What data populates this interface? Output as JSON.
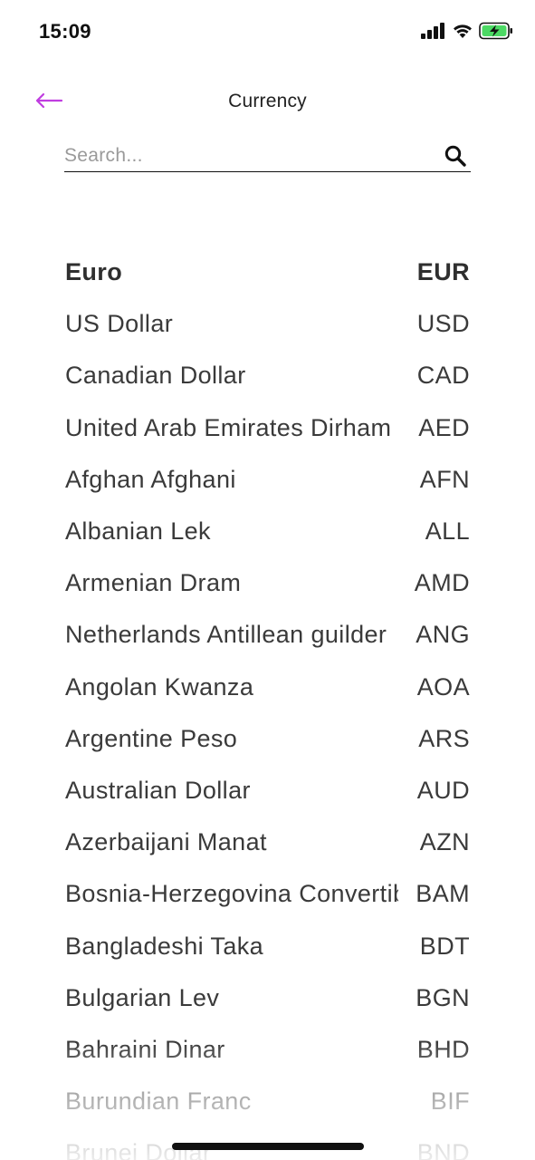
{
  "status_bar": {
    "time": "15:09",
    "icons": [
      "cellular-signal-icon",
      "wifi-icon",
      "battery-charging-icon"
    ],
    "battery_color": "#4cd964"
  },
  "header": {
    "title": "Currency",
    "back_icon": "arrow-left-icon",
    "accent_color": "#c03de0"
  },
  "search": {
    "placeholder": "Search...",
    "value": "",
    "icon": "search-icon"
  },
  "currencies": [
    {
      "name": "Euro",
      "code": "EUR",
      "selected": true
    },
    {
      "name": "US Dollar",
      "code": "USD"
    },
    {
      "name": "Canadian Dollar",
      "code": "CAD"
    },
    {
      "name": "United Arab Emirates Dirham",
      "code": "AED"
    },
    {
      "name": "Afghan Afghani",
      "code": "AFN"
    },
    {
      "name": "Albanian Lek",
      "code": "ALL"
    },
    {
      "name": "Armenian Dram",
      "code": "AMD"
    },
    {
      "name": "Netherlands Antillean guilder",
      "code": "ANG"
    },
    {
      "name": "Angolan Kwanza",
      "code": "AOA"
    },
    {
      "name": "Argentine Peso",
      "code": "ARS"
    },
    {
      "name": "Australian Dollar",
      "code": "AUD"
    },
    {
      "name": "Azerbaijani Manat",
      "code": "AZN"
    },
    {
      "name": "Bosnia-Herzegovina Convertible Mark",
      "code": "BAM"
    },
    {
      "name": "Bangladeshi Taka",
      "code": "BDT"
    },
    {
      "name": "Bulgarian Lev",
      "code": "BGN"
    },
    {
      "name": "Bahraini Dinar",
      "code": "BHD"
    },
    {
      "name": "Burundian Franc",
      "code": "BIF"
    },
    {
      "name": "Brunei Dollar",
      "code": "BND"
    }
  ]
}
